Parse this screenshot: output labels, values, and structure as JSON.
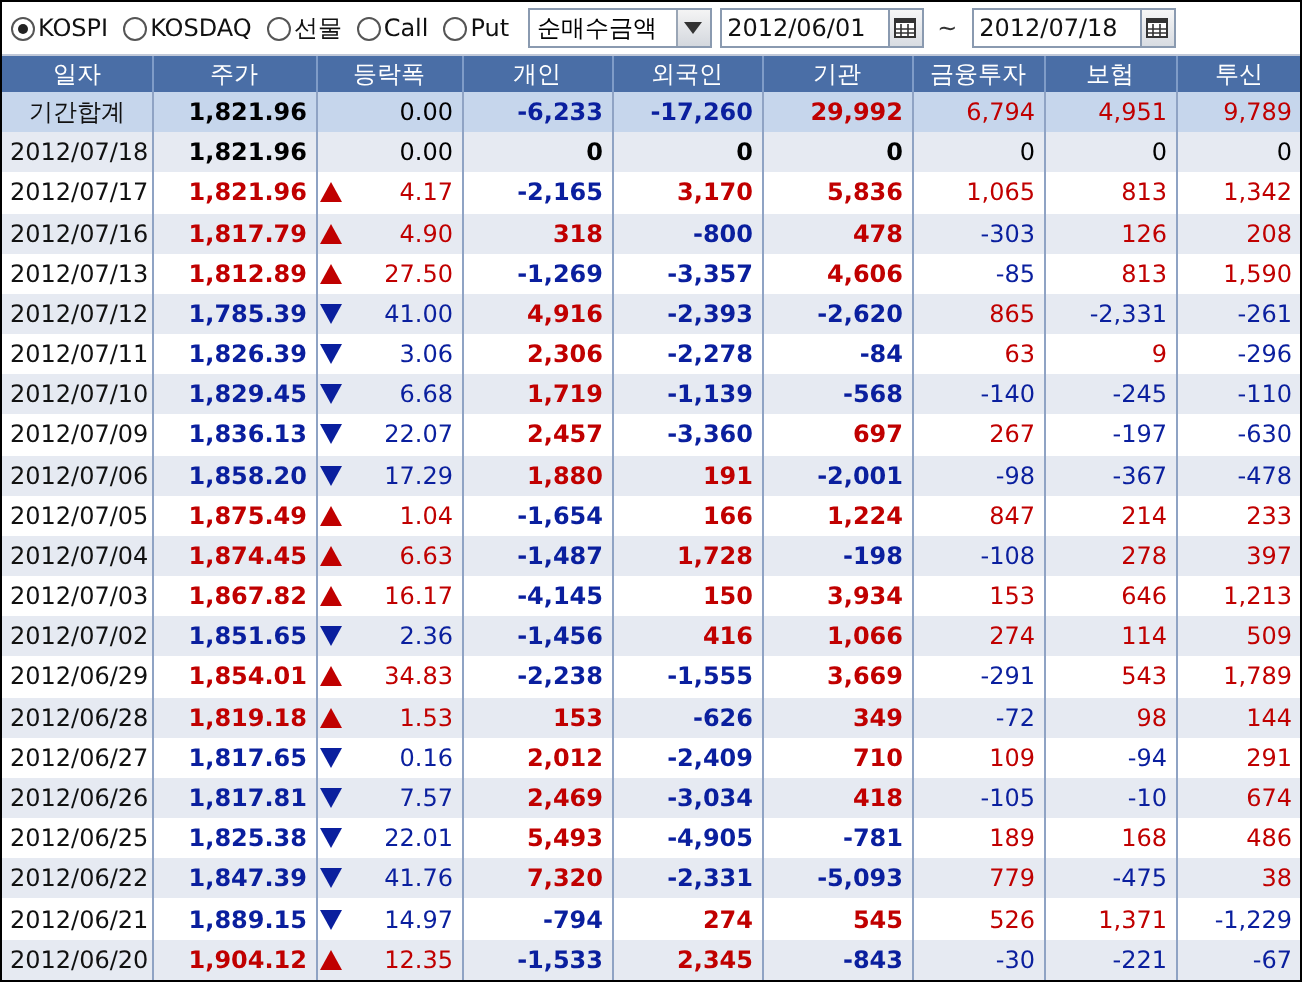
{
  "filters": [
    {
      "label": "KOSPI",
      "selected": true
    },
    {
      "label": "KOSDAQ",
      "selected": false
    },
    {
      "label": "선물",
      "selected": false
    },
    {
      "label": "Call",
      "selected": false
    },
    {
      "label": "Put",
      "selected": false
    }
  ],
  "metric_select": {
    "value": "순매수금액"
  },
  "date_from": {
    "value": "2012/06/01"
  },
  "date_separator": "~",
  "date_to": {
    "value": "2012/07/18"
  },
  "table": {
    "columns": [
      "일자",
      "주가",
      "등락폭",
      "개인",
      "외국인",
      "기관",
      "금융투자",
      "보험",
      "투신"
    ],
    "rows": [
      {
        "kind": "summary",
        "date": "기간합계",
        "price": "1,821.96",
        "up": false,
        "down": false,
        "change": "0.00",
        "values": [
          "-6,233",
          "-17,260",
          "29,992",
          "6,794",
          "4,951",
          "9,789"
        ]
      },
      {
        "kind": "day",
        "date": "2012/07/18",
        "price": "1,821.96",
        "up": false,
        "down": false,
        "change": "0.00",
        "values": [
          "0",
          "0",
          "0",
          "0",
          "0",
          "0"
        ]
      },
      {
        "kind": "day",
        "date": "2012/07/17",
        "price": "1,821.96",
        "up": true,
        "down": false,
        "change": "4.17",
        "values": [
          "-2,165",
          "3,170",
          "5,836",
          "1,065",
          "813",
          "1,342"
        ]
      },
      {
        "kind": "day",
        "date": "2012/07/16",
        "price": "1,817.79",
        "up": true,
        "down": false,
        "change": "4.90",
        "values": [
          "318",
          "-800",
          "478",
          "-303",
          "126",
          "208"
        ]
      },
      {
        "kind": "day",
        "date": "2012/07/13",
        "price": "1,812.89",
        "up": true,
        "down": false,
        "change": "27.50",
        "values": [
          "-1,269",
          "-3,357",
          "4,606",
          "-85",
          "813",
          "1,590"
        ]
      },
      {
        "kind": "day",
        "date": "2012/07/12",
        "price": "1,785.39",
        "up": false,
        "down": true,
        "change": "41.00",
        "values": [
          "4,916",
          "-2,393",
          "-2,620",
          "865",
          "-2,331",
          "-261"
        ]
      },
      {
        "kind": "day",
        "date": "2012/07/11",
        "price": "1,826.39",
        "up": false,
        "down": true,
        "change": "3.06",
        "values": [
          "2,306",
          "-2,278",
          "-84",
          "63",
          "9",
          "-296"
        ]
      },
      {
        "kind": "day",
        "date": "2012/07/10",
        "price": "1,829.45",
        "up": false,
        "down": true,
        "change": "6.68",
        "values": [
          "1,719",
          "-1,139",
          "-568",
          "-140",
          "-245",
          "-110"
        ]
      },
      {
        "kind": "day",
        "date": "2012/07/09",
        "price": "1,836.13",
        "up": false,
        "down": true,
        "change": "22.07",
        "values": [
          "2,457",
          "-3,360",
          "697",
          "267",
          "-197",
          "-630"
        ]
      },
      {
        "kind": "day",
        "date": "2012/07/06",
        "price": "1,858.20",
        "up": false,
        "down": true,
        "change": "17.29",
        "values": [
          "1,880",
          "191",
          "-2,001",
          "-98",
          "-367",
          "-478"
        ]
      },
      {
        "kind": "day",
        "date": "2012/07/05",
        "price": "1,875.49",
        "up": true,
        "down": false,
        "change": "1.04",
        "values": [
          "-1,654",
          "166",
          "1,224",
          "847",
          "214",
          "233"
        ]
      },
      {
        "kind": "day",
        "date": "2012/07/04",
        "price": "1,874.45",
        "up": true,
        "down": false,
        "change": "6.63",
        "values": [
          "-1,487",
          "1,728",
          "-198",
          "-108",
          "278",
          "397"
        ]
      },
      {
        "kind": "day",
        "date": "2012/07/03",
        "price": "1,867.82",
        "up": true,
        "down": false,
        "change": "16.17",
        "values": [
          "-4,145",
          "150",
          "3,934",
          "153",
          "646",
          "1,213"
        ]
      },
      {
        "kind": "day",
        "date": "2012/07/02",
        "price": "1,851.65",
        "up": false,
        "down": true,
        "change": "2.36",
        "values": [
          "-1,456",
          "416",
          "1,066",
          "274",
          "114",
          "509"
        ]
      },
      {
        "kind": "day",
        "date": "2012/06/29",
        "price": "1,854.01",
        "up": true,
        "down": false,
        "change": "34.83",
        "values": [
          "-2,238",
          "-1,555",
          "3,669",
          "-291",
          "543",
          "1,789"
        ]
      },
      {
        "kind": "day",
        "date": "2012/06/28",
        "price": "1,819.18",
        "up": true,
        "down": false,
        "change": "1.53",
        "values": [
          "153",
          "-626",
          "349",
          "-72",
          "98",
          "144"
        ]
      },
      {
        "kind": "day",
        "date": "2012/06/27",
        "price": "1,817.65",
        "up": false,
        "down": true,
        "change": "0.16",
        "values": [
          "2,012",
          "-2,409",
          "710",
          "109",
          "-94",
          "291"
        ]
      },
      {
        "kind": "day",
        "date": "2012/06/26",
        "price": "1,817.81",
        "up": false,
        "down": true,
        "change": "7.57",
        "values": [
          "2,469",
          "-3,034",
          "418",
          "-105",
          "-10",
          "674"
        ]
      },
      {
        "kind": "day",
        "date": "2012/06/25",
        "price": "1,825.38",
        "up": false,
        "down": true,
        "change": "22.01",
        "values": [
          "5,493",
          "-4,905",
          "-781",
          "189",
          "168",
          "486"
        ]
      },
      {
        "kind": "day",
        "date": "2012/06/22",
        "price": "1,847.39",
        "up": false,
        "down": true,
        "change": "41.76",
        "values": [
          "7,320",
          "-2,331",
          "-5,093",
          "779",
          "-475",
          "38"
        ]
      },
      {
        "kind": "day",
        "date": "2012/06/21",
        "price": "1,889.15",
        "up": false,
        "down": true,
        "change": "14.97",
        "values": [
          "-794",
          "274",
          "545",
          "526",
          "1,371",
          "-1,229"
        ]
      },
      {
        "kind": "day",
        "date": "2012/06/20",
        "price": "1,904.12",
        "up": true,
        "down": false,
        "change": "12.35",
        "values": [
          "-1,533",
          "2,345",
          "-843",
          "-30",
          "-221",
          "-67"
        ]
      }
    ]
  }
}
